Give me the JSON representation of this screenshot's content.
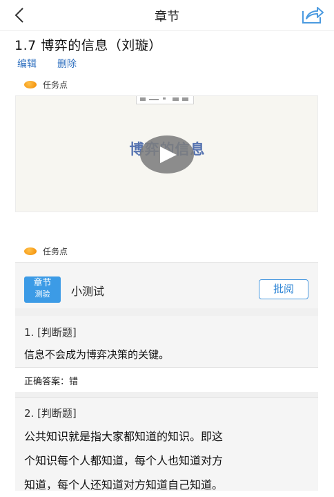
{
  "header": {
    "title": "章节",
    "back_icon": "chevron-left-icon",
    "share_icon": "share-icon",
    "accent_color": "#4a9ae0"
  },
  "chapter": {
    "title": "1.7 博弈的信息（刘璇）",
    "edit_label": "编辑",
    "delete_label": "删除"
  },
  "task_point_label": "任务点",
  "video": {
    "caption": "博弈的信息",
    "play_icon": "play-icon"
  },
  "quiz": {
    "badge_line1": "章节",
    "badge_line2": "测验",
    "title": "小测试",
    "review_label": "批阅",
    "badge_color": "#3c9be6"
  },
  "questions": [
    {
      "type": "1. [判断题]",
      "text": "信息不会成为博弈决策的关键。",
      "answer": "正确答案：错"
    },
    {
      "type": "2. [判断题]",
      "lines": [
        "公共知识就是指大家都知道的知识。即这",
        "个知识每个人都知道，每个人也知道对方",
        "知道，每个人还知道对方知道自己知道。"
      ]
    }
  ]
}
